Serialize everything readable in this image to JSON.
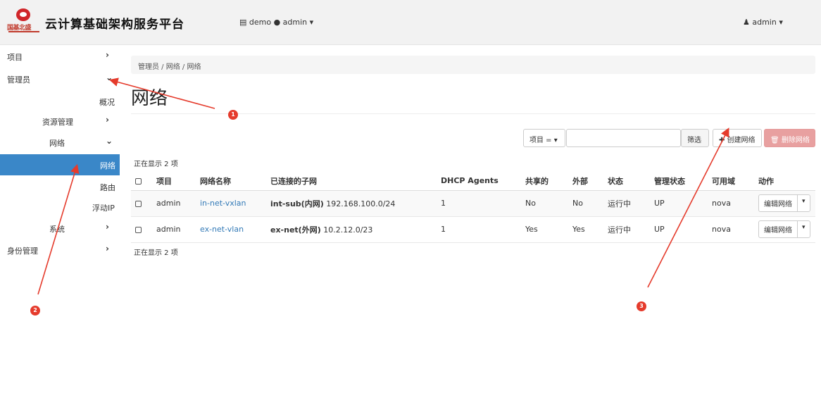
{
  "header": {
    "logo_text": "国基北盛",
    "app_title": "云计算基础架构服务平台",
    "project_switch": "▤ demo ● admin ▾",
    "user_menu": "♟ admin ▾"
  },
  "sidebar": {
    "items": [
      {
        "label": "项目",
        "chevron": "›"
      },
      {
        "label": "管理员",
        "chevron": "⌄"
      },
      {
        "label": "概况"
      },
      {
        "label": "资源管理",
        "chevron": "›"
      },
      {
        "label": "网络",
        "chevron": "⌄"
      },
      {
        "label": "网络"
      },
      {
        "label": "路由"
      },
      {
        "label": "浮动IP"
      },
      {
        "label": "系统",
        "chevron": "›"
      },
      {
        "label": "身份管理",
        "chevron": "›"
      }
    ]
  },
  "breadcrumb": "管理员 / 网络 / 网络",
  "page_title": "网络",
  "toolbar": {
    "filter_select": "项目 = ▾",
    "filter_button": "筛选",
    "create_button": "✚ 创建网络",
    "delete_button": "🗑 删除网络"
  },
  "count_top": "正在显示 2 项",
  "count_bottom": "正在显示 2 项",
  "table": {
    "headers": [
      "项目",
      "网络名称",
      "已连接的子网",
      "DHCP Agents",
      "共享的",
      "外部",
      "状态",
      "管理状态",
      "可用域",
      "动作"
    ],
    "rows": [
      {
        "project": "admin",
        "name": "in-net-vxlan",
        "subnet_name": "int-sub(内网)",
        "subnet_cidr": "192.168.100.0/24",
        "dhcp": "1",
        "shared": "No",
        "external": "No",
        "status": "运行中",
        "admin_state": "UP",
        "zone": "nova",
        "action": "编辑网络",
        "caret": "▾"
      },
      {
        "project": "admin",
        "name": "ex-net-vlan",
        "subnet_name": "ex-net(外网)",
        "subnet_cidr": "10.2.12.0/23",
        "dhcp": "1",
        "shared": "Yes",
        "external": "Yes",
        "status": "运行中",
        "admin_state": "UP",
        "zone": "nova",
        "action": "编辑网络",
        "caret": "▾"
      }
    ]
  },
  "annotations": {
    "badges": [
      "1",
      "2",
      "3"
    ],
    "color": "#e53b2c"
  }
}
